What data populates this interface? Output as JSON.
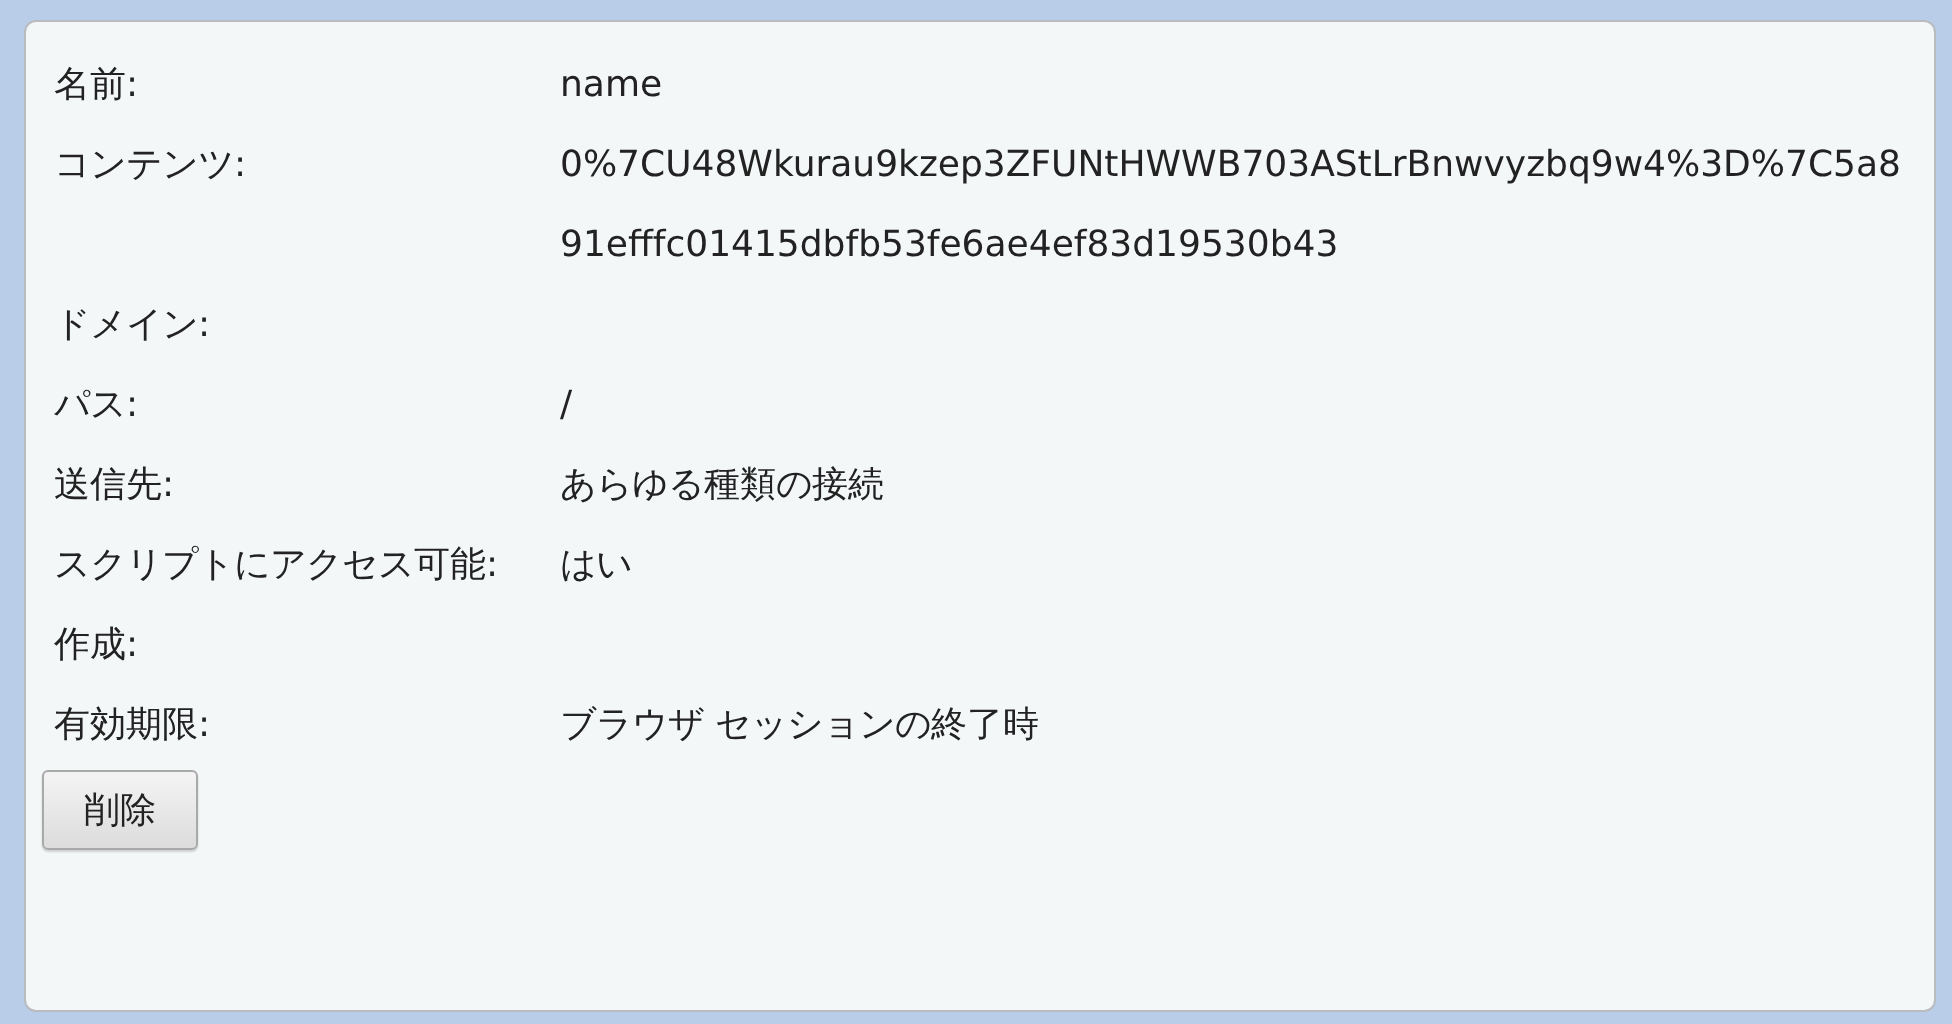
{
  "fields": [
    {
      "label": "名前:",
      "value": "name"
    },
    {
      "label": "コンテンツ:",
      "value": "0%7CU48Wkurau9kzep3ZFUNtHWWB703AStLrBnwvyzbq9w4%3D%7C5a891efffc01415dbfb53fe6ae4ef83d19530b43"
    },
    {
      "label": "ドメイン:"
    },
    {
      "label": "パス:",
      "value": "/"
    },
    {
      "label": "送信先:",
      "value": "あらゆる種類の接続"
    },
    {
      "label": "スクリプトにアクセス可能:",
      "value": "はい"
    },
    {
      "label": "作成:"
    },
    {
      "label": "有効期限:",
      "value": "ブラウザ セッションの終了時"
    }
  ],
  "buttons": [
    "削除"
  ]
}
